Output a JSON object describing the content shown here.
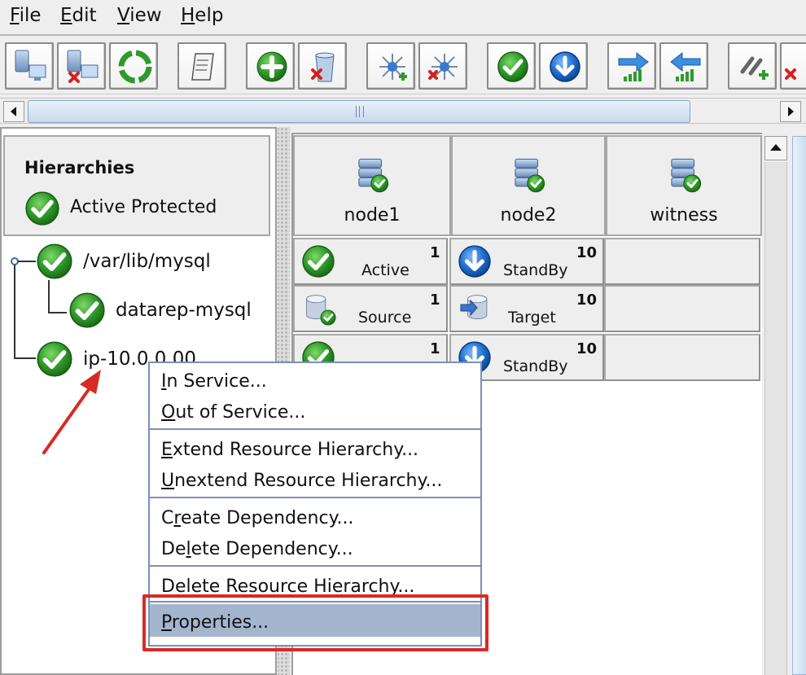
{
  "menubar": {
    "items": [
      {
        "mnemonic": "F",
        "rest": "ile"
      },
      {
        "mnemonic": "E",
        "rest": "dit"
      },
      {
        "mnemonic": "V",
        "rest": "iew"
      },
      {
        "mnemonic": "H",
        "rest": "elp"
      }
    ]
  },
  "toolbar": {
    "buttons": [
      {
        "icon": "connect-server-icon"
      },
      {
        "icon": "disconnect-server-icon"
      },
      {
        "icon": "refresh-icon"
      },
      {
        "icon": "log-scroll-icon"
      },
      {
        "icon": "create-resource-icon"
      },
      {
        "icon": "delete-resource-icon"
      },
      {
        "icon": "extend-hierarchy-icon"
      },
      {
        "icon": "unextend-hierarchy-icon"
      },
      {
        "icon": "in-service-icon"
      },
      {
        "icon": "out-of-service-icon"
      },
      {
        "icon": "extend-right-icon"
      },
      {
        "icon": "extend-left-icon"
      },
      {
        "icon": "create-dependency-icon"
      },
      {
        "icon": "delete-dependency-icon"
      }
    ]
  },
  "hierarchies": {
    "title": "Hierarchies",
    "status": "Active Protected",
    "tree": [
      {
        "label": "/var/lib/mysql",
        "icon": "active-check-icon"
      },
      {
        "label": "datarep-mysql",
        "icon": "active-check-icon"
      },
      {
        "label": "ip-10.0.0.00",
        "icon": "active-check-icon"
      }
    ]
  },
  "nodes": [
    {
      "name": "node1",
      "icon": "server-active-icon"
    },
    {
      "name": "node2",
      "icon": "server-active-icon"
    },
    {
      "name": "witness",
      "icon": "server-active-icon"
    }
  ],
  "status_rows": [
    [
      {
        "label": "Active",
        "priority": "1",
        "icon": "active-check-icon"
      },
      {
        "label": "StandBy",
        "priority": "10",
        "icon": "standby-arrow-icon"
      },
      {
        "label": "",
        "priority": ""
      }
    ],
    [
      {
        "label": "Source",
        "priority": "1",
        "icon": "mirror-source-icon"
      },
      {
        "label": "Target",
        "priority": "10",
        "icon": "mirror-target-icon"
      },
      {
        "label": "",
        "priority": ""
      }
    ],
    [
      {
        "label": "",
        "priority": "1",
        "icon": "active-check-icon"
      },
      {
        "label": "StandBy",
        "priority": "10",
        "icon": "standby-arrow-icon"
      },
      {
        "label": "",
        "priority": ""
      }
    ]
  ],
  "context_menu": {
    "items": [
      {
        "pre": "",
        "mnemonic": "I",
        "rest": "n Service..."
      },
      {
        "pre": "",
        "mnemonic": "O",
        "rest": "ut of Service..."
      },
      {
        "pre": "",
        "mnemonic": "E",
        "rest": "xtend Resource Hierarchy..."
      },
      {
        "pre": "",
        "mnemonic": "U",
        "rest": "nextend Resource Hierarchy..."
      },
      {
        "pre": "C",
        "mnemonic": "r",
        "rest": "eate Dependency..."
      },
      {
        "pre": "De",
        "mnemonic": "l",
        "rest": "ete Dependency..."
      },
      {
        "pre": "Delete Resource Hierarchy...",
        "mnemonic": "",
        "rest": ""
      },
      {
        "pre": "",
        "mnemonic": "P",
        "rest": "roperties..."
      }
    ],
    "selected": "Properties..."
  },
  "colors": {
    "check_green": "#2f9a2a",
    "standby_blue": "#1f6fd0",
    "annotation_red": "#d92a24",
    "menu_border": "#7b8fb8",
    "menu_selected": "#a4b5ce"
  }
}
